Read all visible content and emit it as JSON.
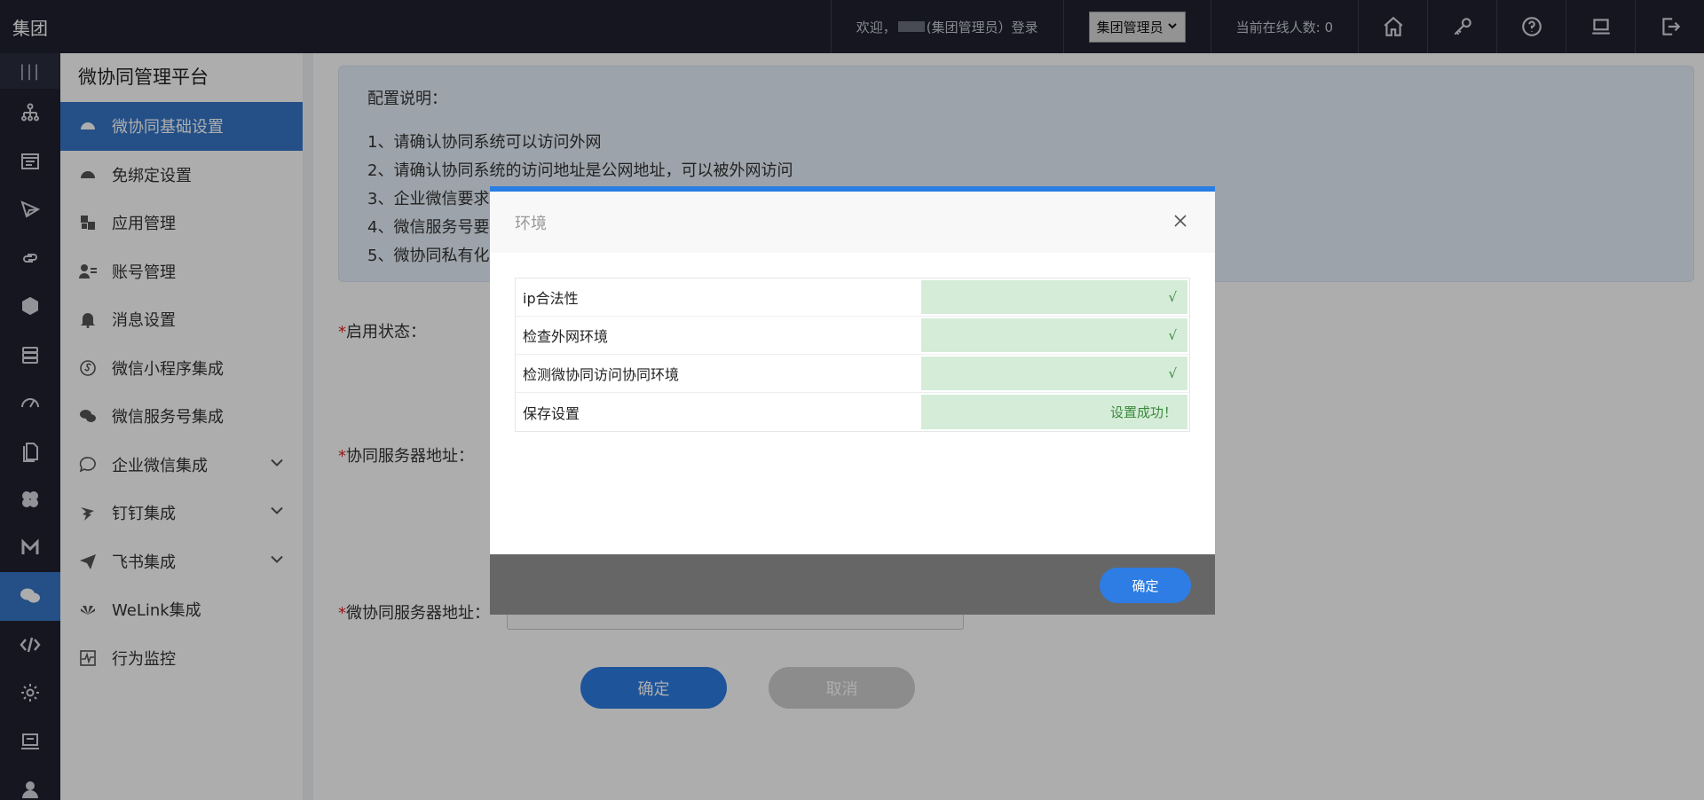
{
  "topbar": {
    "brand": "集团",
    "welcome_prefix": "欢迎，",
    "welcome_suffix": "(集团管理员）登录",
    "role_select": "集团管理员",
    "online_label": "当前在线人数: 0",
    "icons": [
      "home-icon",
      "key-icon",
      "help-icon",
      "monitor-icon",
      "logout-icon"
    ]
  },
  "rail": {
    "toggle": "|||",
    "icons": [
      "org-tree-icon",
      "form-icon",
      "send-icon",
      "link-icon",
      "cap-icon",
      "database-icon",
      "dashboard-icon",
      "document-icon",
      "clover-icon",
      "m-logo-icon",
      "wechat-icon",
      "code-icon",
      "settings-icon",
      "screen-icon",
      "user-icon"
    ],
    "active_index": 10
  },
  "sidebar": {
    "title": "微协同管理平台",
    "items": [
      {
        "label": "微协同基础设置",
        "icon": "dashboard-icon",
        "active": true
      },
      {
        "label": "免绑定设置",
        "icon": "dashboard-icon"
      },
      {
        "label": "应用管理",
        "icon": "cubes-icon"
      },
      {
        "label": "账号管理",
        "icon": "user-card-icon"
      },
      {
        "label": "消息设置",
        "icon": "bell-icon"
      },
      {
        "label": "微信小程序集成",
        "icon": "miniprogram-icon"
      },
      {
        "label": "微信服务号集成",
        "icon": "wechat-icon"
      },
      {
        "label": "企业微信集成",
        "icon": "chat-icon",
        "expandable": true
      },
      {
        "label": "钉钉集成",
        "icon": "dingtalk-icon",
        "expandable": true
      },
      {
        "label": "飞书集成",
        "icon": "feishu-icon",
        "expandable": true
      },
      {
        "label": "WeLink集成",
        "icon": "huawei-icon"
      },
      {
        "label": "行为监控",
        "icon": "monitor-chart-icon"
      }
    ]
  },
  "main": {
    "notice": {
      "title": "配置说明：",
      "lines": [
        "1、请确认协同系统可以访问外网",
        "2、请确认协同系统的访问地址是公网地址，可以被外网访问",
        "3、企业微信要求",
        "4、微信服务号要",
        "5、微协同私有化"
      ]
    },
    "labels": {
      "status": "启用状态：",
      "server": "协同服务器地址：",
      "micro_server": "微协同服务器地址："
    },
    "required_mark": "*",
    "buttons": {
      "ok": "确定",
      "cancel": "取消"
    }
  },
  "modal": {
    "title": "环境",
    "rows": [
      {
        "name": "ip合法性",
        "status": "√"
      },
      {
        "name": "检查外网环境",
        "status": "√"
      },
      {
        "name": "检测微协同访问协同环境",
        "status": "√"
      },
      {
        "name": "保存设置",
        "status": "设置成功！"
      }
    ],
    "ok_label": "确定"
  },
  "colors": {
    "accent": "#2d7de4",
    "topbar_bg": "#1f2130",
    "success_bg": "#d5ecd9"
  }
}
